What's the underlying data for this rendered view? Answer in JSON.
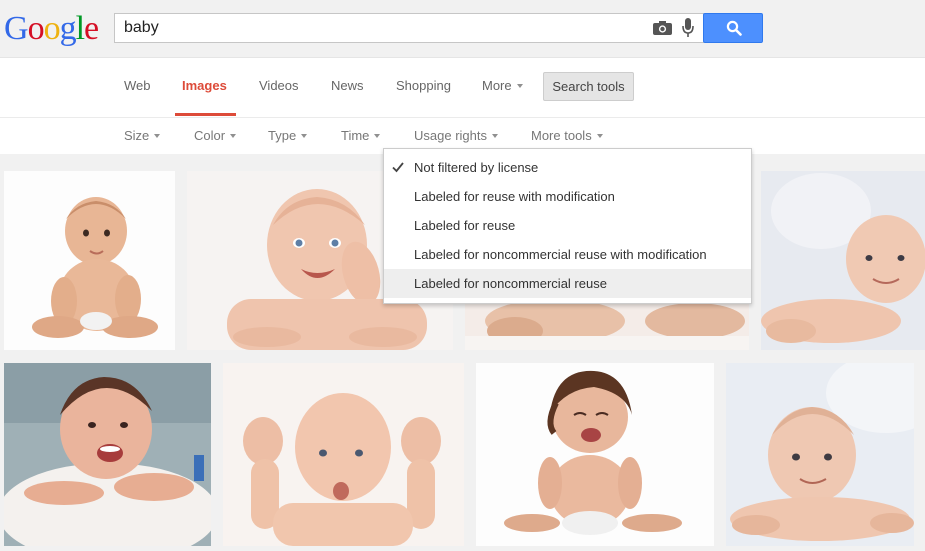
{
  "brand": {
    "logo_letters": [
      {
        "char": "G",
        "color": "#3369e8"
      },
      {
        "char": "o",
        "color": "#d50f25"
      },
      {
        "char": "o",
        "color": "#eeb211"
      },
      {
        "char": "g",
        "color": "#3369e8"
      },
      {
        "char": "l",
        "color": "#009925"
      },
      {
        "char": "e",
        "color": "#d50f25"
      }
    ]
  },
  "search": {
    "query": "baby",
    "camera_icon": "camera-icon",
    "mic_icon": "microphone-icon",
    "button_icon": "magnifier-icon"
  },
  "nav": {
    "items": [
      {
        "label": "Web",
        "active": false
      },
      {
        "label": "Images",
        "active": true
      },
      {
        "label": "Videos",
        "active": false
      },
      {
        "label": "News",
        "active": false
      },
      {
        "label": "Shopping",
        "active": false
      },
      {
        "label": "More",
        "active": false
      }
    ],
    "search_tools": "Search tools"
  },
  "tools": {
    "items": [
      "Size",
      "Color",
      "Type",
      "Time",
      "Usage rights",
      "More tools"
    ]
  },
  "usage_rights_menu": {
    "options": [
      {
        "label": "Not filtered by license",
        "checked": true
      },
      {
        "label": "Labeled for reuse with modification",
        "checked": false
      },
      {
        "label": "Labeled for reuse",
        "checked": false
      },
      {
        "label": "Labeled for noncommercial reuse with modification",
        "checked": false
      },
      {
        "label": "Labeled for noncommercial reuse",
        "checked": false,
        "hovered": true
      }
    ]
  },
  "colors": {
    "accent_red": "#dd4b39",
    "search_blue": "#4d90fe"
  },
  "results": {
    "image_count": 9
  }
}
